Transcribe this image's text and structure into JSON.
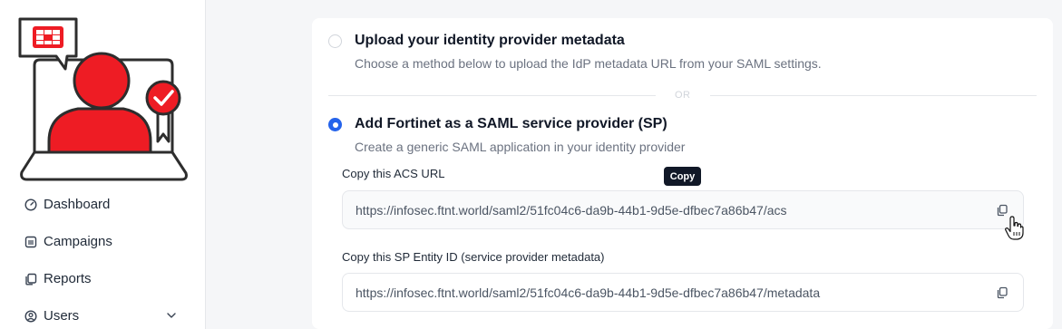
{
  "sidebar": {
    "items": [
      {
        "label": "Dashboard",
        "icon": "gauge-icon"
      },
      {
        "label": "Campaigns",
        "icon": "calendar-icon"
      },
      {
        "label": "Reports",
        "icon": "copy-icon"
      },
      {
        "label": "Users",
        "icon": "user-circle-icon",
        "has_chevron": true
      }
    ]
  },
  "options": {
    "upload": {
      "title": "Upload your identity provider metadata",
      "description": "Choose a method below to upload the IdP metadata URL from your SAML settings.",
      "selected": false
    },
    "divider": "OR",
    "sp": {
      "title": "Add Fortinet as a SAML service provider (SP)",
      "description": "Create a generic SAML application in your identity provider",
      "selected": true
    }
  },
  "acs": {
    "label": "Copy this ACS URL",
    "value": "https://infosec.ftnt.world/saml2/51fc04c6-da9b-44b1-9d5e-dfbec7a86b47/acs"
  },
  "entity": {
    "label": "Copy this SP Entity ID (service provider metadata)",
    "value": "https://infosec.ftnt.world/saml2/51fc04c6-da9b-44b1-9d5e-dfbec7a86b47/metadata"
  },
  "tooltip": "Copy",
  "colors": {
    "brand_red": "#ee1c24",
    "accent_blue": "#2563eb",
    "outline": "#2d2d2d"
  }
}
